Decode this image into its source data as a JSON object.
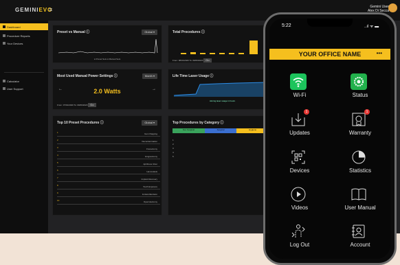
{
  "brand": {
    "logo_main": "GEMINI",
    "logo_accent": "EVO"
  },
  "user": {
    "name_line1": "Gemini User",
    "name_line2": "Alex Di Secca"
  },
  "sidebar": {
    "items": [
      {
        "label": "Dashboard"
      },
      {
        "label": "Procedure Reports"
      },
      {
        "label": "Your Devices"
      },
      {
        "label": "Calculator"
      },
      {
        "label": "User Support"
      }
    ]
  },
  "panels": {
    "preset_vs_manual": {
      "title": "Preset vs Manual ⓘ",
      "dropdown": "Global ▾",
      "legend": "● Preset Sets   ● Manual Sets"
    },
    "total_procedures": {
      "title": "Total Procedures ⓘ",
      "from": "From:",
      "to": "To:",
      "from_val": "08/31/2020",
      "to_val": "09/06/2020",
      "go": "Go"
    },
    "most_used": {
      "title": "Most Used Manual Power Settings ⓘ",
      "dropdown": "Month ▾",
      "value": "2.0 Watts",
      "from": "From:",
      "to": "To:",
      "from_val": "07/01/2020",
      "to_val": "09/06/2020",
      "go": "Go"
    },
    "lifetime": {
      "title": "Life Time Laser Usage ⓘ",
      "caption": "Aiming laser usage in hours"
    },
    "top10": {
      "title": "Top 10 Preset Procedures ⓘ",
      "dropdown": "Global ▾"
    },
    "category": {
      "title": "Top Procedures by Category ⓘ",
      "tabs": [
        "Non Surgical",
        "Surgical",
        "Hygiene"
      ]
    }
  },
  "top10_list": [
    {
      "rank": "1",
      "name": "Gum Flapping"
    },
    {
      "rank": "2",
      "name": "Decontamination"
    },
    {
      "rank": "3",
      "name": "Frenectomy"
    },
    {
      "rank": "4",
      "name": "Gingivectomy"
    },
    {
      "rank": "5",
      "name": "Aphthous Ulcer"
    },
    {
      "rank": "6",
      "name": "Hemostasis"
    },
    {
      "rank": "7",
      "name": "Implant Recovery"
    },
    {
      "rank": "8",
      "name": "Tooth Exposure"
    },
    {
      "rank": "9",
      "name": "Incision/Excision"
    },
    {
      "rank": "10",
      "name": "Operculectomy"
    }
  ],
  "phone": {
    "time": "5:22",
    "signal": "..ıl ᯤ ▬",
    "office": "YOUR OFFICE NAME",
    "more": "•••",
    "tiles": [
      {
        "label": "Wi-Fi",
        "icon": "wifi-icon"
      },
      {
        "label": "Status",
        "icon": "gear-icon"
      },
      {
        "label": "Updates",
        "icon": "download-icon"
      },
      {
        "label": "Warranty",
        "icon": "certificate-icon"
      },
      {
        "label": "Devices",
        "icon": "qr-code-icon"
      },
      {
        "label": "Statistics",
        "icon": "pie-chart-icon"
      },
      {
        "label": "Videos",
        "icon": "play-icon"
      },
      {
        "label": "User Manual",
        "icon": "book-icon"
      },
      {
        "label": "Log Out",
        "icon": "logout-icon"
      },
      {
        "label": "Account",
        "icon": "account-book-icon"
      }
    ],
    "badges": {
      "updates": "1",
      "warranty": "1"
    }
  },
  "colors": {
    "accent": "#f5bf1e",
    "wifi": "#1cc45c",
    "status": "#22b14c",
    "chart": "#2c8ce6"
  }
}
